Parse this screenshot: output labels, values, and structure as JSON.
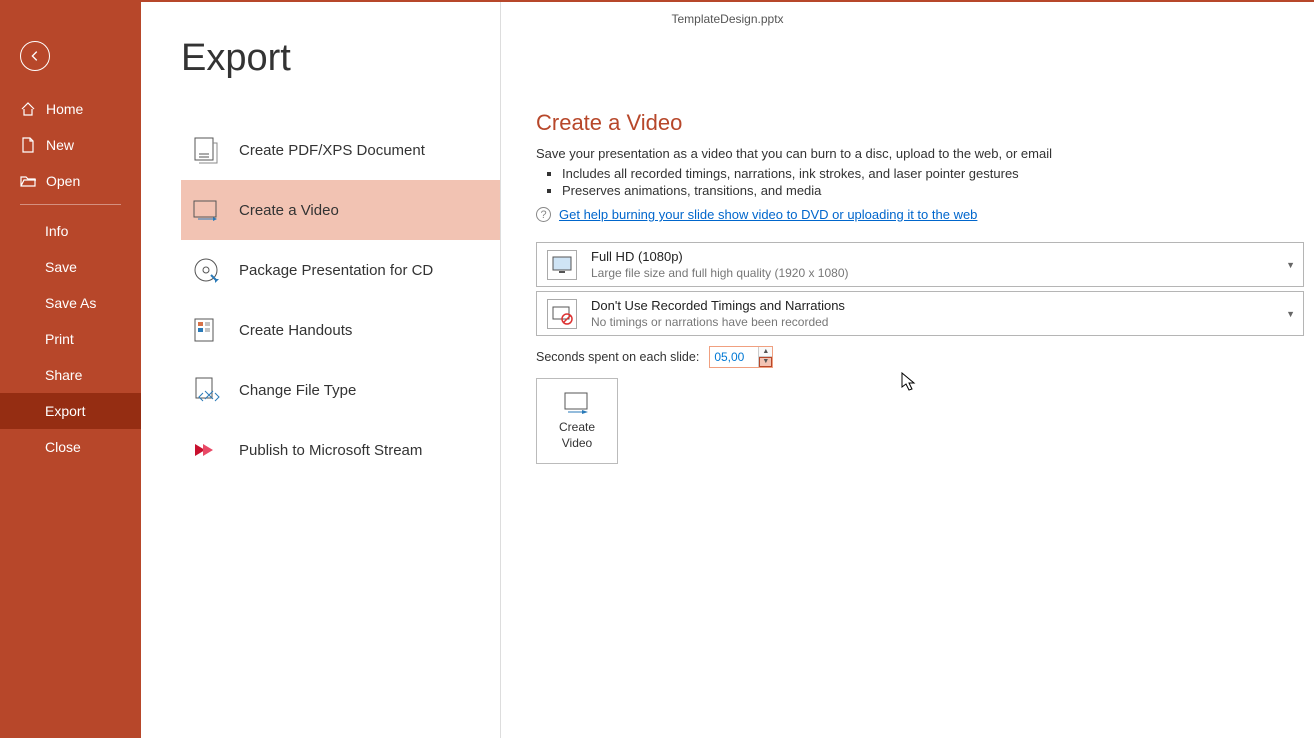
{
  "doc_title": "TemplateDesign.pptx",
  "sidebar": {
    "back": "←",
    "home": "Home",
    "new": "New",
    "open": "Open",
    "info": "Info",
    "save": "Save",
    "save_as": "Save As",
    "print": "Print",
    "share": "Share",
    "export": "Export",
    "close": "Close"
  },
  "export": {
    "title": "Export",
    "opts": {
      "pdf": "Create PDF/XPS Document",
      "video": "Create a Video",
      "cd": "Package Presentation for CD",
      "handouts": "Create Handouts",
      "filetype": "Change File Type",
      "stream": "Publish to Microsoft Stream"
    }
  },
  "panel": {
    "title": "Create a Video",
    "desc": "Save your presentation as a video that you can burn to a disc, upload to the web, or email",
    "bullet1": "Includes all recorded timings, narrations, ink strokes, and laser pointer gestures",
    "bullet2": "Preserves animations, transitions, and media",
    "help": "Get help burning your slide show video to DVD or uploading it to the web",
    "dd1_main": "Full HD (1080p)",
    "dd1_sub": "Large file size and full high quality (1920 x 1080)",
    "dd2_main": "Don't Use Recorded Timings and Narrations",
    "dd2_sub": "No timings or narrations have been recorded",
    "seconds_label": "Seconds spent on each slide:",
    "seconds_value": "05,00",
    "create_btn_l1": "Create",
    "create_btn_l2": "Video"
  }
}
